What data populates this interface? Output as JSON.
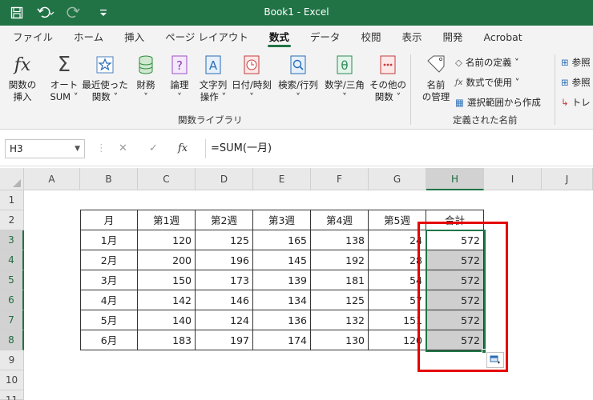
{
  "title_bar": {
    "title": "Book1  -  Excel",
    "accent": "#217346"
  },
  "tabs": [
    {
      "label": "ファイル"
    },
    {
      "label": "ホーム"
    },
    {
      "label": "挿入"
    },
    {
      "label": "ページ レイアウト"
    },
    {
      "label": "数式",
      "active": true
    },
    {
      "label": "データ"
    },
    {
      "label": "校閲"
    },
    {
      "label": "表示"
    },
    {
      "label": "開発"
    },
    {
      "label": "Acrobat"
    }
  ],
  "ribbon": {
    "insert_function": {
      "label1": "関数の",
      "label2": "挿入",
      "icon": "fx-icon"
    },
    "autosum": {
      "label1": "オート",
      "label2": "SUM ˅",
      "icon": "sigma-icon"
    },
    "recent": {
      "label1": "最近使った",
      "label2": "関数 ˅",
      "icon": "star-icon"
    },
    "financial": {
      "label1": "財務",
      "label2": "˅",
      "icon": "database-icon"
    },
    "logical": {
      "label1": "論理",
      "label2": "˅",
      "icon": "question-icon"
    },
    "text": {
      "label1": "文字列",
      "label2": "操作 ˅",
      "icon": "text-icon"
    },
    "datetime": {
      "label1": "日付/時刻",
      "label2": "˅",
      "icon": "clock-icon"
    },
    "lookup": {
      "label1": "検索/行列",
      "label2": "˅",
      "icon": "magnifier-icon"
    },
    "math": {
      "label1": "数学/三角",
      "label2": "˅",
      "icon": "theta-icon"
    },
    "more": {
      "label1": "その他の",
      "label2": "関数 ˅",
      "icon": "more-icon"
    },
    "library_group": "関数ライブラリ",
    "name_manager": {
      "label1": "名前",
      "label2": "の管理",
      "icon": "tag-icon"
    },
    "define_name": "名前の定義  ˅",
    "use_in_formula": "数式で使用 ˅",
    "create_from_selection": "選択範囲から作成",
    "names_group": "定義された名前",
    "trace1": "参照",
    "trace2": "参照",
    "trace3": "トレ"
  },
  "formula_bar": {
    "name_box": "H3",
    "cancel": "✕",
    "enter": "✓",
    "fx": "fx",
    "formula": "=SUM(一月)"
  },
  "columns": [
    "A",
    "B",
    "C",
    "D",
    "E",
    "F",
    "G",
    "H",
    "I",
    "J"
  ],
  "rows": [
    "1",
    "2",
    "3",
    "4",
    "5",
    "6",
    "7",
    "8",
    "9",
    "10",
    "11"
  ],
  "table": {
    "headers": [
      "月",
      "第1週",
      "第2週",
      "第3週",
      "第4週",
      "第5週",
      "合計"
    ],
    "data": [
      [
        "1月",
        "120",
        "125",
        "165",
        "138",
        "24",
        "572"
      ],
      [
        "2月",
        "200",
        "196",
        "145",
        "192",
        "28",
        "572"
      ],
      [
        "3月",
        "150",
        "173",
        "139",
        "181",
        "54",
        "572"
      ],
      [
        "4月",
        "142",
        "146",
        "134",
        "125",
        "57",
        "572"
      ],
      [
        "5月",
        "140",
        "124",
        "136",
        "132",
        "151",
        "572"
      ],
      [
        "6月",
        "183",
        "197",
        "174",
        "130",
        "120",
        "572"
      ]
    ]
  },
  "active_cell": "H3",
  "highlight_color": "#e60000"
}
